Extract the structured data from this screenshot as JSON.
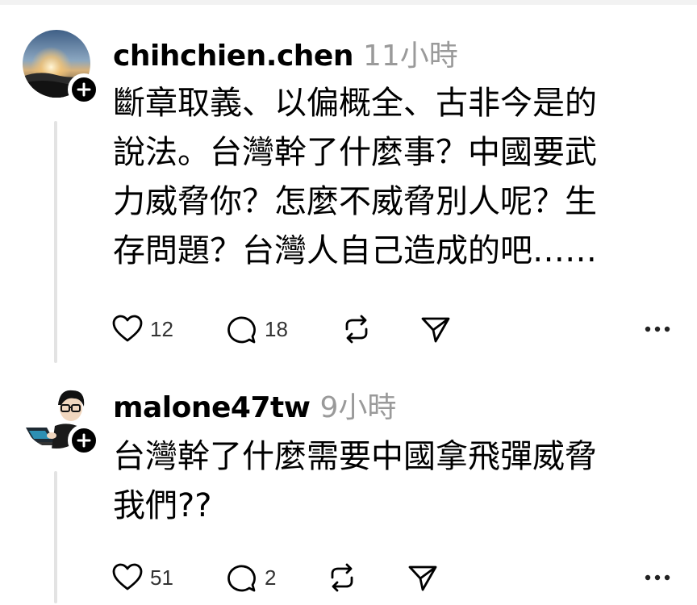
{
  "posts": [
    {
      "username": "chihchien.chen",
      "time": "11小時",
      "text": "斷章取義、以偏概全、古非今是的\n說法。台灣幹了什麼事？中國要武\n力威脅你？怎麼不威脅別人呢？生\n存問題？台灣人自己造成的吧……",
      "likes": "12",
      "comments": "18"
    },
    {
      "username": "malone47tw",
      "time": "9小時",
      "text": "台灣幹了什麼需要中國拿飛彈威脅\n我們??",
      "likes": "51",
      "comments": "2"
    }
  ],
  "icons": {
    "like": "heart-icon",
    "comment": "comment-bubble-icon",
    "repost": "repost-icon",
    "share": "send-icon",
    "more": "more-dots-icon",
    "follow": "plus-icon"
  },
  "colors": {
    "text": "#000000",
    "muted": "#9a9a9a",
    "thread_line": "#e3e3e3"
  }
}
